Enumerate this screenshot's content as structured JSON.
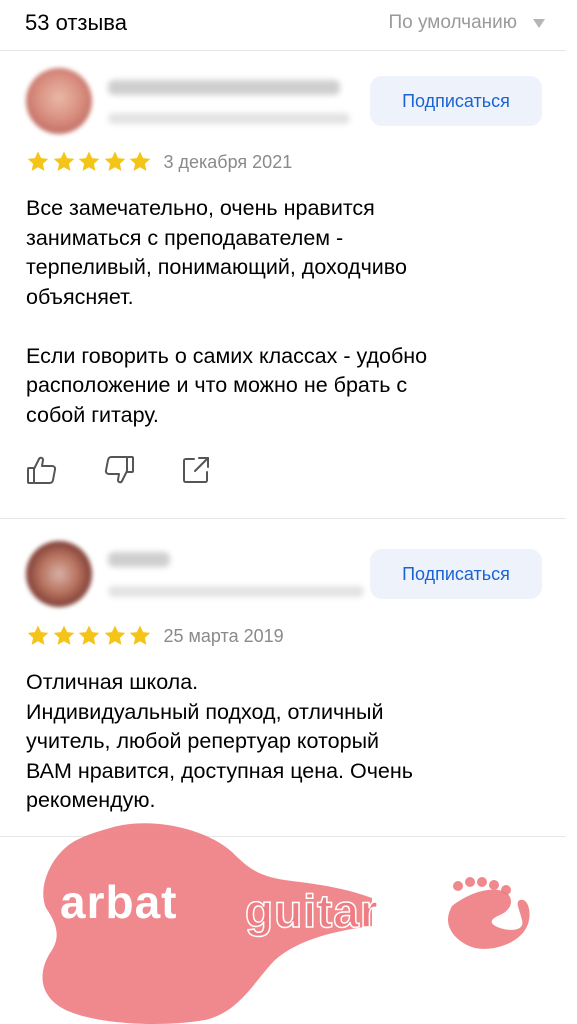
{
  "header": {
    "count": "53 отзыва",
    "sort_label": "По умолчанию"
  },
  "reviews": [
    {
      "subscribe_label": "Подписаться",
      "rating": 5,
      "date": "3 декабря 2021",
      "text": "Все замечательно, очень нравится\nзаниматься с преподавателем -\nтерпеливый, понимающий, доходчиво\nобъясняет.\n\nЕсли говорить о самих классах - удобно\nрасположение и что можно не брать с\nсобой гитару."
    },
    {
      "subscribe_label": "Подписаться",
      "rating": 5,
      "date": "25 марта 2019",
      "text": "Отличная школа.\nИндивидуальный подход, отличный\nучитель, любой репертуар который\nВАМ нравится, доступная цена. Очень\nрекомендую."
    }
  ],
  "watermark": {
    "word1": "arbat",
    "word2": "guitar"
  },
  "colors": {
    "accent": "#1b62d4",
    "star": "#f5c418",
    "button_bg": "#eef3fb",
    "logo": "#ee7c82"
  }
}
